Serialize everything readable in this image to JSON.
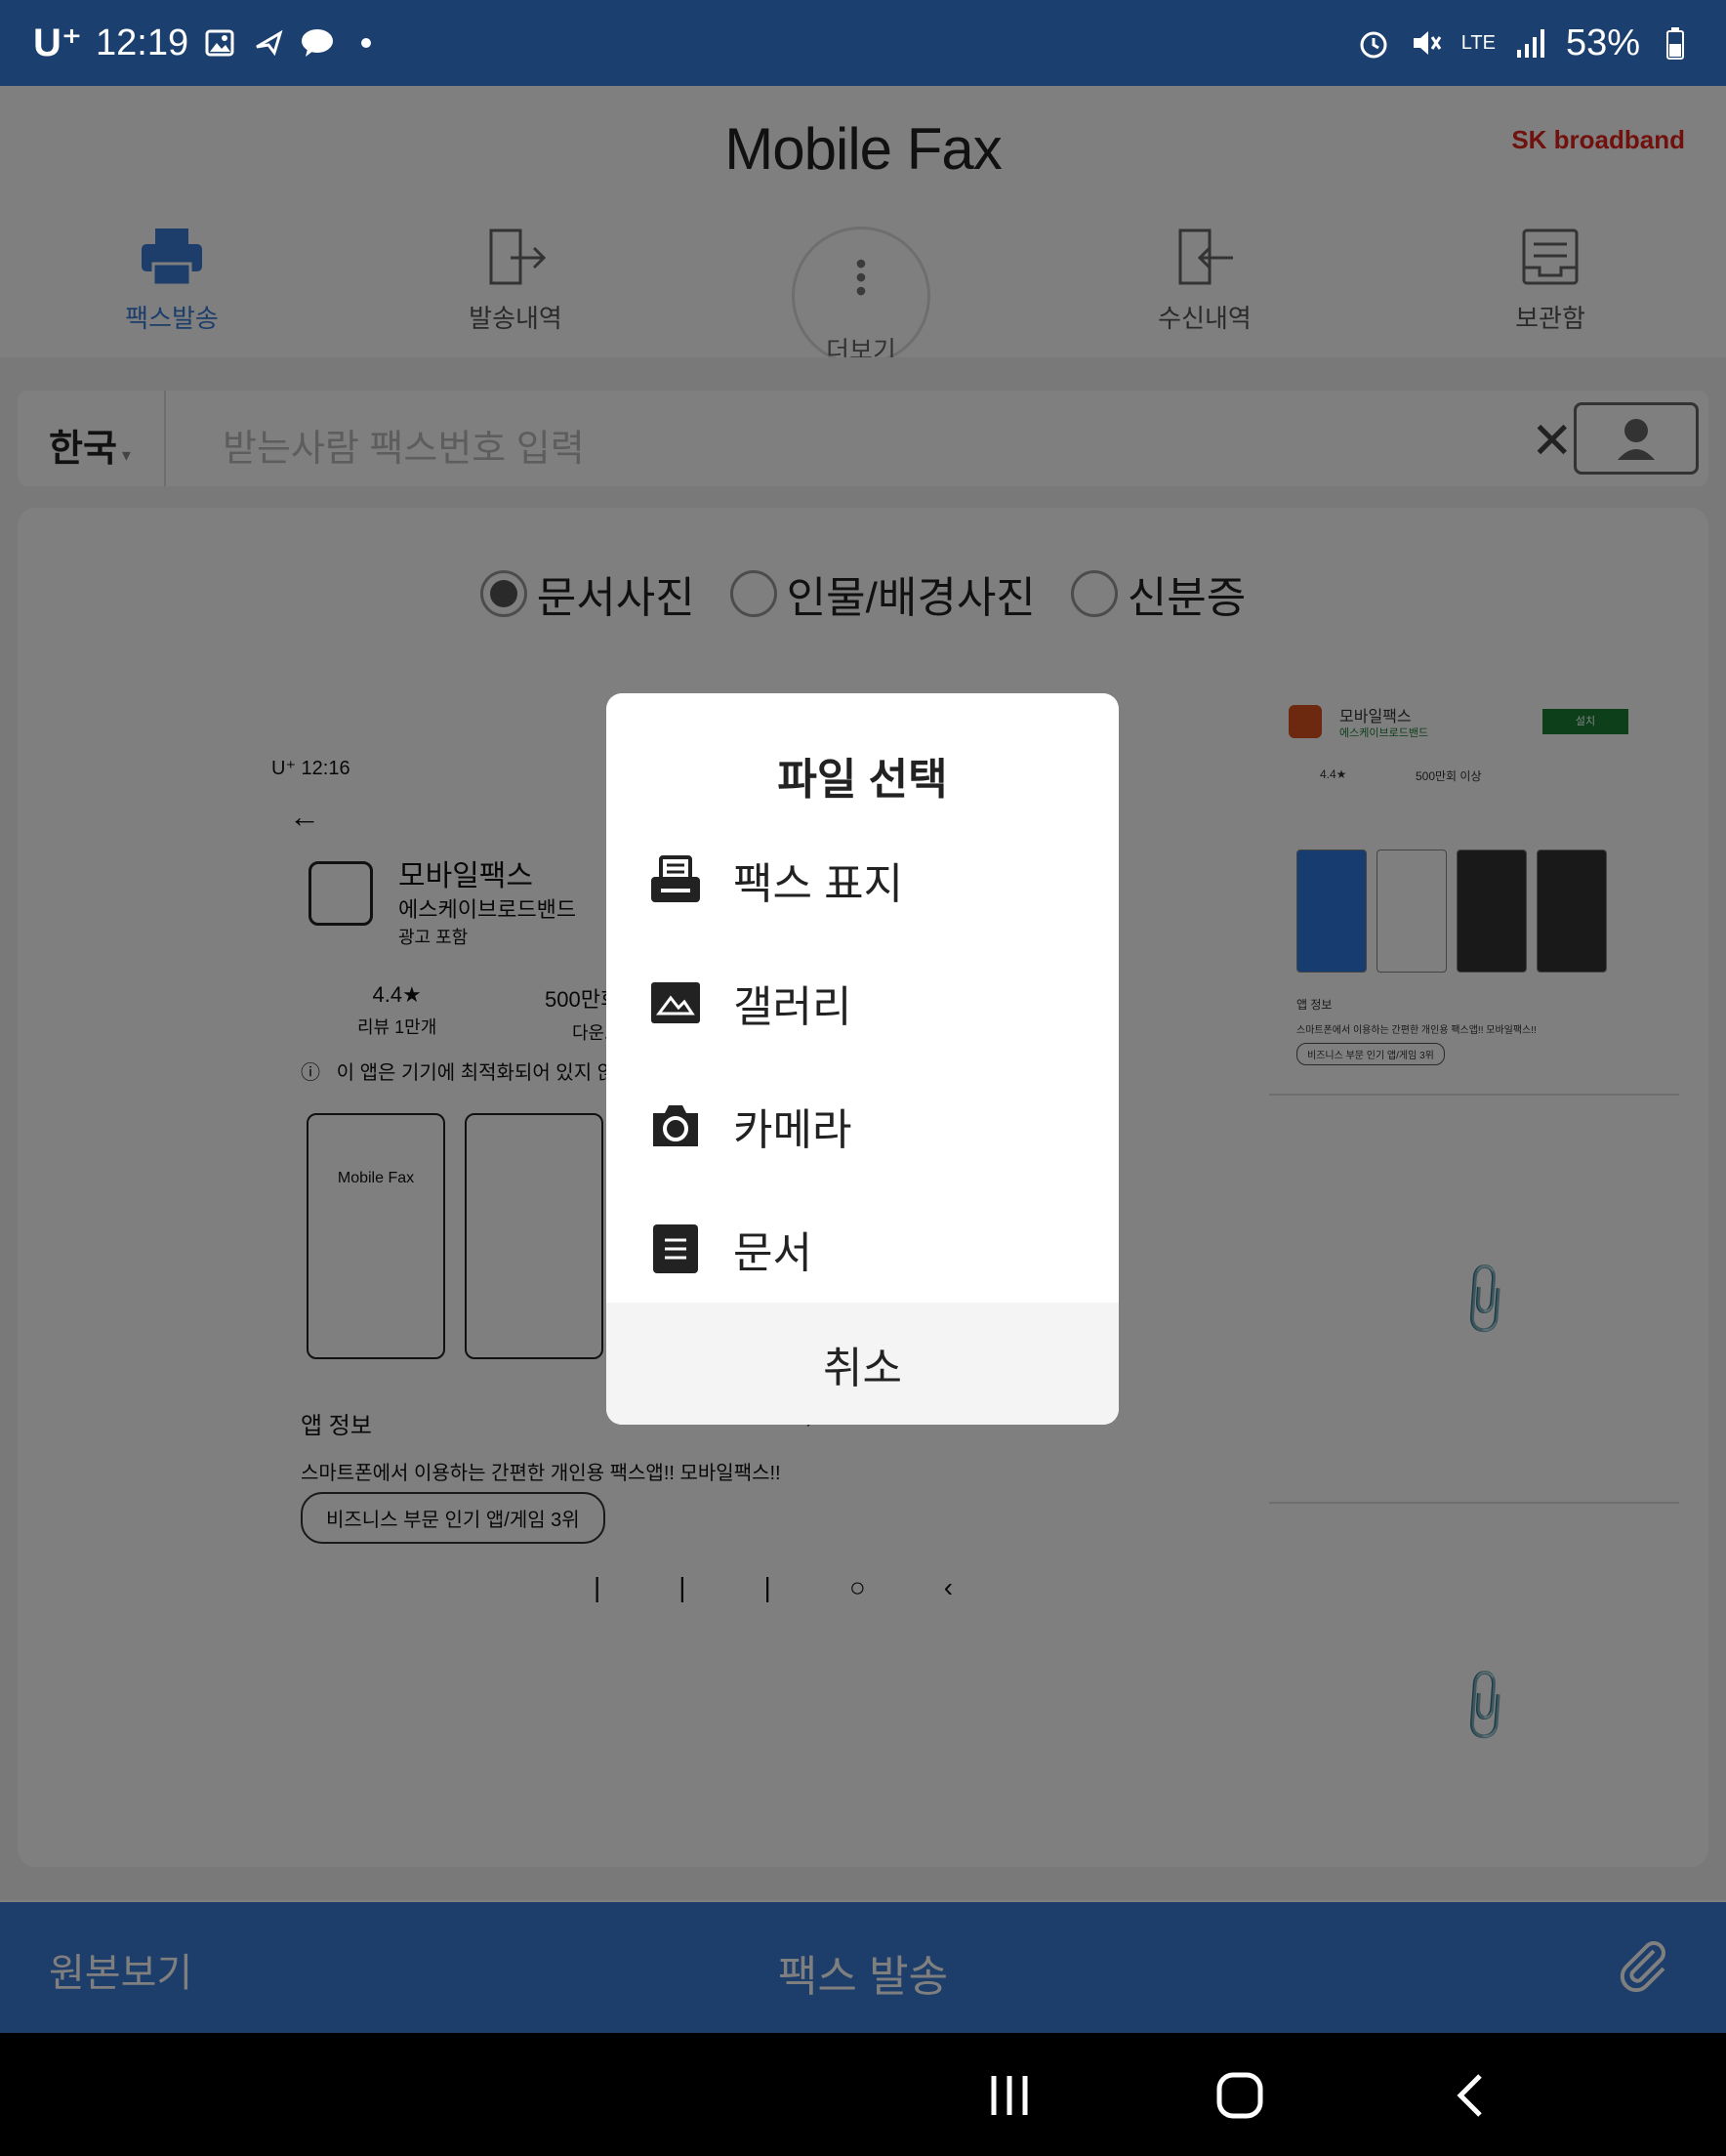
{
  "status_bar": {
    "carrier": "U⁺",
    "time": "12:19",
    "network": "LTE",
    "battery": "53%"
  },
  "app": {
    "title": "Mobile Fax",
    "brand_logo": "SK broadband"
  },
  "tabs": [
    {
      "label": "팩스발송",
      "icon": "printer-icon",
      "active": true
    },
    {
      "label": "발송내역",
      "icon": "outbox-icon",
      "active": false
    },
    {
      "label": "더보기",
      "icon": "more-icon",
      "active": false
    },
    {
      "label": "수신내역",
      "icon": "inbox-icon",
      "active": false
    },
    {
      "label": "보관함",
      "icon": "archive-icon",
      "active": false
    }
  ],
  "recipient": {
    "country": "한국",
    "placeholder": "받는사람 팩스번호 입력"
  },
  "photo_types": [
    {
      "label": "문서사진",
      "selected": true
    },
    {
      "label": "인물/배경사진",
      "selected": false
    },
    {
      "label": "신분증",
      "selected": false
    }
  ],
  "preview": {
    "status": "U⁺ 12:16",
    "app_name": "모바일팩스",
    "developer": "에스케이브로드밴드",
    "ads": "광고 포함",
    "rating": "4.4★",
    "reviews": "리뷰 1만개",
    "downloads": "500만회",
    "downloads_label": "다운로",
    "warning": "이 앱은 기기에 최적화되어 있지 않",
    "app_info": "앱 정보",
    "description": "스마트폰에서 이용하는 간편한 개인용 팩스앱!! 모바일팩스!!",
    "chip": "비즈니스 부문 인기 앱/게임 3위",
    "thumb_title": "Mobile Fax",
    "side_app_name": "모바일팩스",
    "side_dev": "에스케이브로드밴드",
    "side_install": "설치",
    "side_rating": "4.4★",
    "side_downloads": "500만회 이상",
    "side_info": "앱 정보",
    "side_desc": "스마트폰에서 이용하는 간편한 개인용 팩스앱!! 모바일팩스!!",
    "side_chip": "비즈니스 부문 인기 앱/게임 3위"
  },
  "bottom_bar": {
    "original_view": "원본보기",
    "send_fax": "팩스 발송"
  },
  "dialog": {
    "title": "파일 선택",
    "items": [
      {
        "label": "팩스 표지",
        "icon": "fax-cover-icon"
      },
      {
        "label": "갤러리",
        "icon": "gallery-icon"
      },
      {
        "label": "카메라",
        "icon": "camera-icon"
      },
      {
        "label": "문서",
        "icon": "document-icon"
      }
    ],
    "cancel": "취소"
  },
  "colors": {
    "status_bar": "#1b3f6e",
    "accent": "#3a7bd5",
    "dialog_bg": "#ffffff"
  }
}
